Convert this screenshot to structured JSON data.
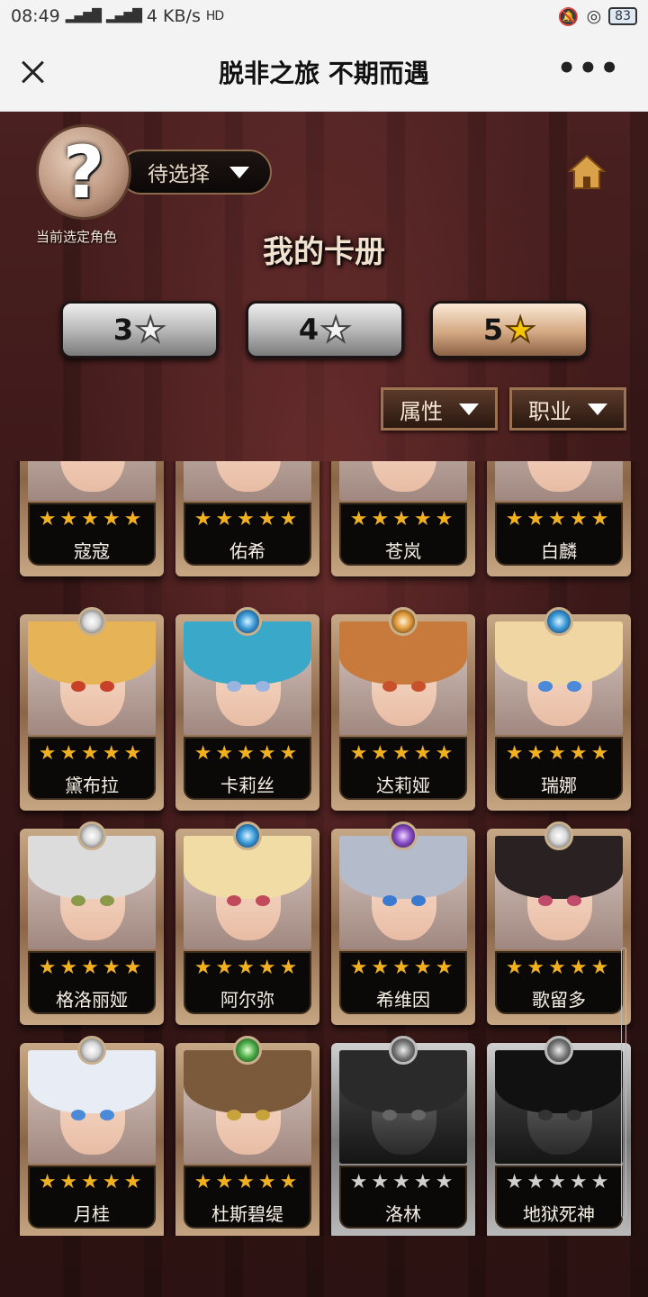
{
  "status": {
    "time": "08:49",
    "net_left": "⁴ᴳ",
    "net_right": "⁴ᴳ",
    "speed": "4 KB/s",
    "hd": "HD",
    "battery": "83"
  },
  "titlebar": {
    "title": "脱非之旅 不期而遇",
    "more": "•••"
  },
  "game": {
    "avatar_mark": "?",
    "select_label": "待选择",
    "caption": "当前选定角色",
    "page_title": "我的卡册",
    "star_buttons": [
      {
        "label": "3",
        "star": "★"
      },
      {
        "label": "4",
        "star": "★"
      },
      {
        "label": "5",
        "star": "★"
      }
    ],
    "filters": [
      {
        "label": "属性"
      },
      {
        "label": "职业"
      }
    ]
  },
  "colors": {
    "gold_star": "#f0b020",
    "grey_star": "#cfcfcf",
    "background": "#3b1818"
  },
  "cards": [
    {
      "name": "寇寇",
      "stars": "★★★★★",
      "gem": "light",
      "hair": "#f1d7d0",
      "eye": "#6a4a44",
      "locked": false
    },
    {
      "name": "佑希",
      "stars": "★★★★★",
      "gem": "water",
      "hair": "#c9c6ea",
      "eye": "#5a76c8",
      "locked": false
    },
    {
      "name": "苍岚",
      "stars": "★★★★★",
      "gem": "water",
      "hair": "#c8d4e6",
      "eye": "#3a60a0",
      "locked": false
    },
    {
      "name": "白麟",
      "stars": "★★★★★",
      "gem": "light",
      "hair": "#e6e2ea",
      "eye": "#c0302c",
      "locked": false
    },
    {
      "name": "黛布拉",
      "stars": "★★★★★",
      "gem": "light",
      "hair": "#e6b456",
      "eye": "#c8402a",
      "locked": false
    },
    {
      "name": "卡莉丝",
      "stars": "★★★★★",
      "gem": "water",
      "hair": "#3aa8c8",
      "eye": "#9ab4e0",
      "locked": false
    },
    {
      "name": "达莉娅",
      "stars": "★★★★★",
      "gem": "fire",
      "hair": "#c87a3c",
      "eye": "#c8502a",
      "locked": false
    },
    {
      "name": "瑞娜",
      "stars": "★★★★★",
      "gem": "water",
      "hair": "#efd6a2",
      "eye": "#4a8ad8",
      "locked": false
    },
    {
      "name": "格洛丽娅",
      "stars": "★★★★★",
      "gem": "light",
      "hair": "#dcdcdc",
      "eye": "#8a9a4a",
      "locked": false
    },
    {
      "name": "阿尔弥",
      "stars": "★★★★★",
      "gem": "water",
      "hair": "#f0dca4",
      "eye": "#c04a5a",
      "locked": false
    },
    {
      "name": "希维因",
      "stars": "★★★★★",
      "gem": "dark",
      "hair": "#b4bccc",
      "eye": "#3a7ad0",
      "locked": false
    },
    {
      "name": "歌留多",
      "stars": "★★★★★",
      "gem": "light",
      "hair": "#2a2222",
      "eye": "#c04a6a",
      "locked": false
    },
    {
      "name": "月桂",
      "stars": "★★★★★",
      "gem": "light",
      "hair": "#e8ecf4",
      "eye": "#4a8ad8",
      "locked": false
    },
    {
      "name": "杜斯碧缇",
      "stars": "★★★★★",
      "gem": "wind",
      "hair": "#7a5a3a",
      "eye": "#c8a23a",
      "locked": false
    },
    {
      "name": "洛林",
      "stars": "★★★★★",
      "gem": "light",
      "hair": "#2a2a2a",
      "eye": "#666666",
      "locked": true
    },
    {
      "name": "地狱死神",
      "stars": "★★★★★",
      "gem": "light",
      "hair": "#111111",
      "eye": "#333333",
      "locked": true
    }
  ]
}
